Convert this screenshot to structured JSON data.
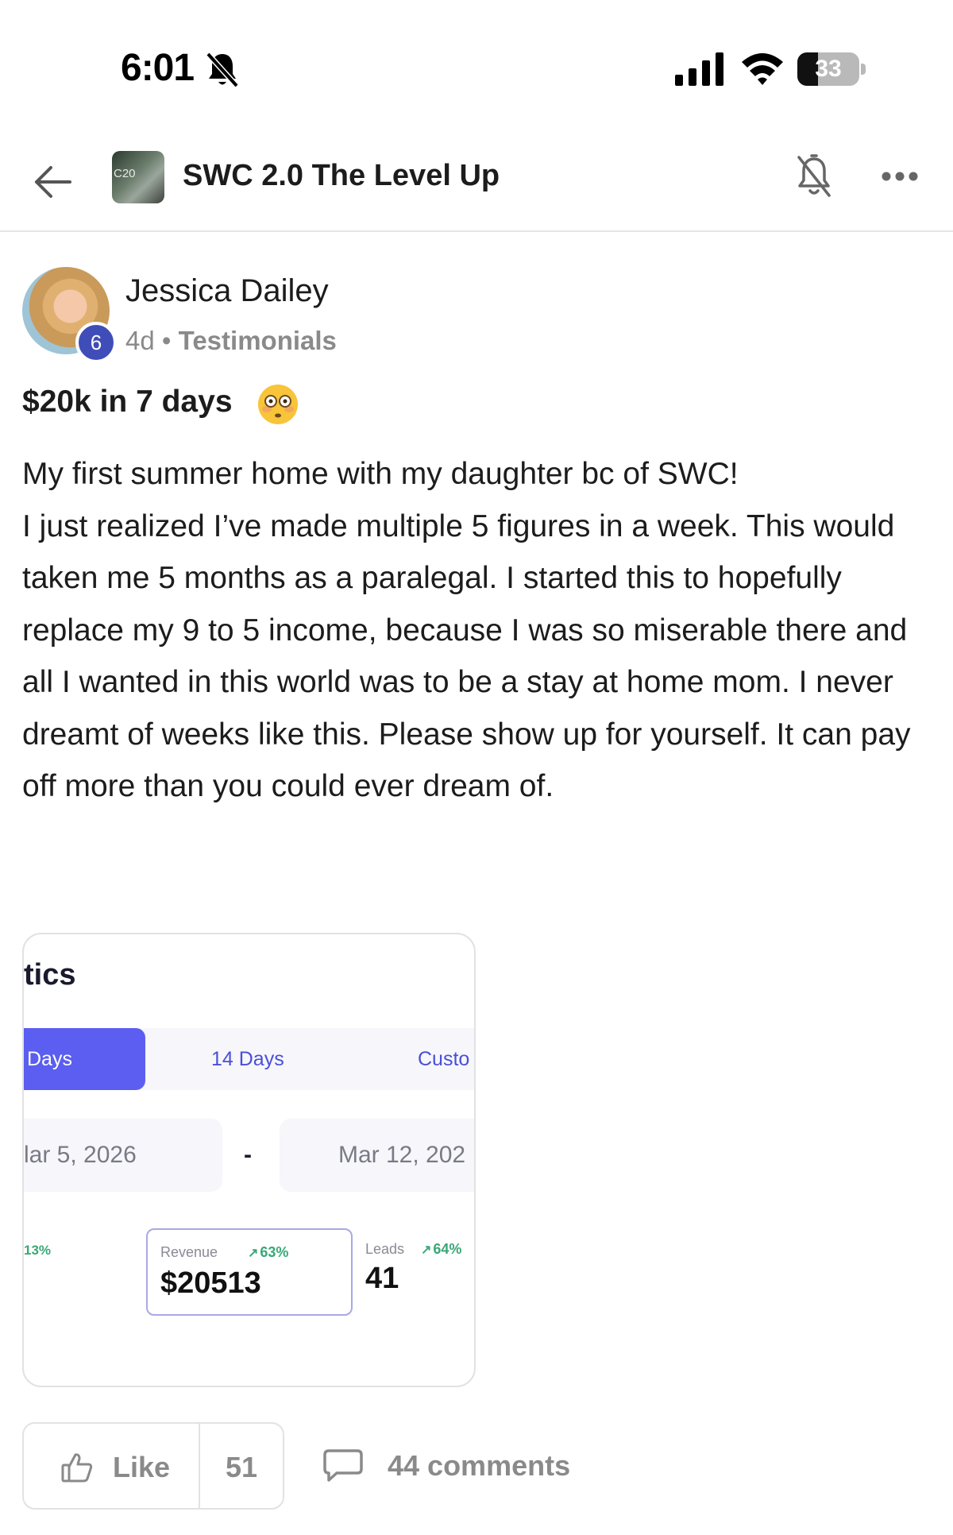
{
  "status_bar": {
    "time": "6:01",
    "battery_level": "33",
    "battery_fraction": 0.33
  },
  "header": {
    "group_name": "SWC 2.0 The Level Up",
    "group_avatar_text": "C20"
  },
  "post": {
    "author": "Jessica Dailey",
    "level": "6",
    "age": "4d",
    "separator": "•",
    "category": "Testimonials",
    "title": "$20k in 7 days",
    "body": "My first summer home with my daughter bc of SWC!\nI just realized I’ve made multiple 5 figures in a week. This would taken me 5 months as a paralegal. I started this to hopefully replace my 9 to 5 income, because I was so miserable there and all I wanted in this world was to be a stay at home mom. I never dreamt of weeks like this. Please show up for yourself. It can pay off more than you could ever dream of."
  },
  "attachment": {
    "title": "tics",
    "tabs": [
      "Days",
      "14 Days",
      "Custo"
    ],
    "date_start": "lar 5, 2026",
    "date_separator": "-",
    "date_end": "Mar 12, 202",
    "left_pct": "13%",
    "revenue": {
      "label": "Revenue",
      "pct": "63%",
      "value": "$20513"
    },
    "leads": {
      "label": "Leads",
      "pct": "64%",
      "value": "41"
    }
  },
  "actions": {
    "like_label": "Like",
    "like_count": "51",
    "comments_label": "44 comments"
  },
  "colors": {
    "accent": "#5b5ef0",
    "badge": "#3f4db8",
    "positive": "#3aa776",
    "muted": "#8a8a8a"
  },
  "icons": [
    "bell-slash-icon",
    "signal-icon",
    "wifi-icon",
    "battery-icon",
    "back-arrow-icon",
    "bell-icon",
    "more-icon",
    "flushed-face-emoji",
    "trend-up-icon",
    "thumbs-up-icon",
    "comment-icon"
  ]
}
